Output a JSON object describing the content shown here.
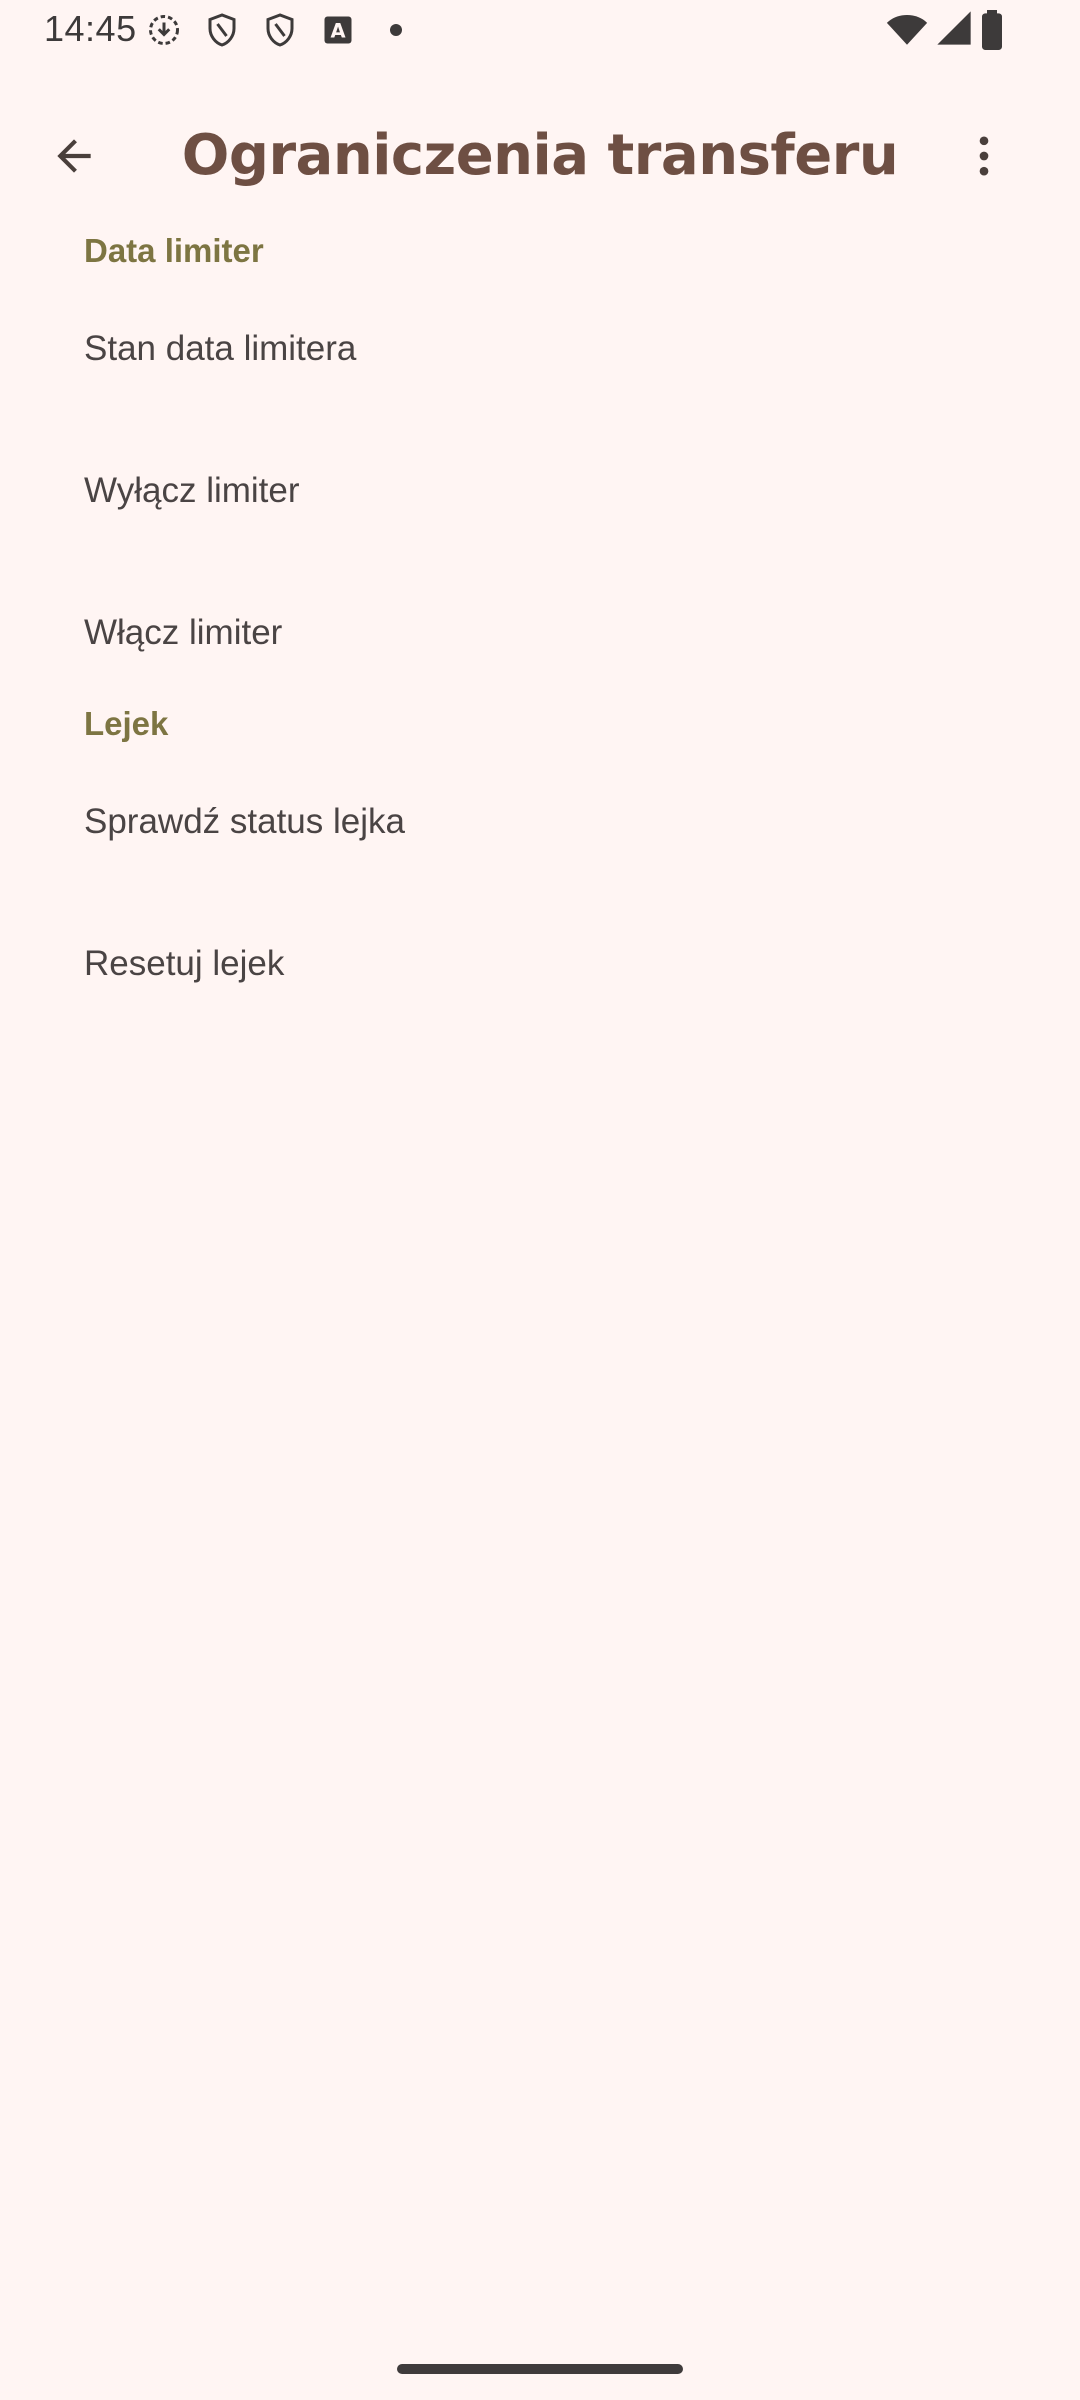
{
  "status_bar": {
    "time": "14:45",
    "icons": [
      "download-status-icon",
      "shield-icon",
      "shield-icon",
      "keyboard-a-icon",
      "dot-icon",
      "wifi-icon",
      "signal-icon",
      "battery-icon"
    ]
  },
  "app_bar": {
    "title": "Ograniczenia transferu",
    "back_icon": "arrow-back-icon",
    "more_icon": "more-vert-icon"
  },
  "sections": [
    {
      "header": "Data limiter",
      "items": [
        "Stan data limitera",
        "Wyłącz limiter",
        "Włącz limiter"
      ]
    },
    {
      "header": "Lejek",
      "items": [
        "Sprawdź status lejka",
        "Resetuj lejek"
      ]
    }
  ],
  "colors": {
    "background": "#fff5f3",
    "title": "#6e4f43",
    "section_header": "#7d7542",
    "item_text": "#4a4444"
  }
}
